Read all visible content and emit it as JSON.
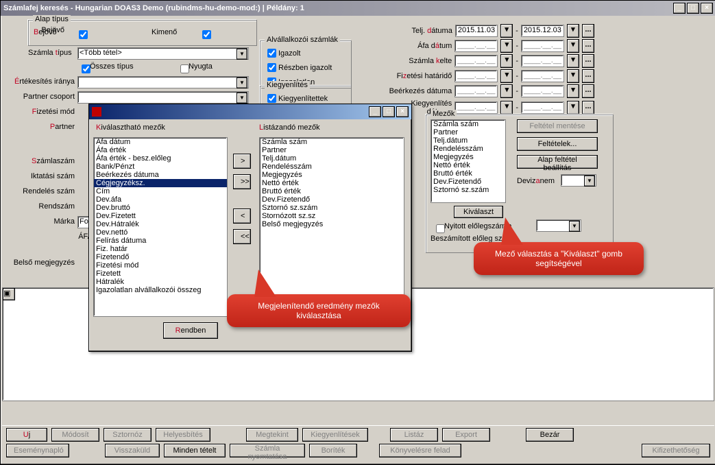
{
  "window": {
    "title": "Számlafej keresés - Hungarian DOAS3 Demo (rubindms-hu-demo-mod:)  |  Példány: 1",
    "min": "_",
    "max": "□",
    "close": "×"
  },
  "alap": {
    "group": "Alap típus",
    "bejovo": "Bejövő",
    "kimeno": "Kimenő"
  },
  "szamla_tipus": {
    "label": "Számla ",
    "label2": "típus",
    "value": "<Több tétel>",
    "osszes": "Összes típus",
    "nyugta": "Nyugta"
  },
  "labels": {
    "ert": "Értékesítés iránya",
    "pcso": "Partner csoport",
    "fiz": "izetési mód",
    "partner": "artner",
    "partnerP": "P",
    "szsz": "zámlaszám",
    "szszS": "S",
    "ikt": "Iktatási szám",
    "rend": "Rendelés szám",
    "rendsz": "Rendszám",
    "marka": "Márka",
    "afa": "ÁFA",
    "belso": "Belső megjegyzés",
    "forc": "Forc"
  },
  "alval": {
    "group": "Alvállalkozói számlák",
    "ig": "Igazolt",
    "re": "Részben igazolt",
    "igl": "Igazolatlan"
  },
  "kiegy": {
    "group": "Kiegyenlítés",
    "k1": "Kiegyenlítettek"
  },
  "dates": {
    "telj": {
      "l": "Telj. ",
      "l2": "dátuma",
      "f": "2015.11.03",
      "t": "2015.12.03"
    },
    "afa": {
      "l": "Áfa d",
      "l2": "átum",
      "f": "____.__.__",
      "t": "____.__.__"
    },
    "kelte": {
      "l": "Számla ",
      "l2": "kelte",
      "f": "____.__.__",
      "t": "____.__.__"
    },
    "hat": {
      "l": "Fi",
      "l2": "zetési határidő",
      "f": "____.__.__",
      "t": "____.__.__"
    },
    "beerk": {
      "l": "Beérkezés dátuma",
      "l2": "",
      "f": "____.__.__",
      "t": "____.__.__"
    },
    "kd": {
      "l": "Kiegyenlítés dátuma",
      "l2": "",
      "f": "____.__.__",
      "t": "____.__.__"
    },
    "dash": "-",
    "dots": "..."
  },
  "mezok": {
    "group": "Mezők",
    "items": [
      "Számla szám",
      "Partner",
      "Telj.dátum",
      "Rendelésszám",
      "Megjegyzés",
      "Nettó érték",
      "Bruttó érték",
      "Dev.Fizetendő",
      "Sztornó sz.szám"
    ],
    "kivalaszt": "Kiválaszt",
    "felt_ment": "Feltétel mentése",
    "feltetelek": "Feltételek...",
    "alap": "Alap feltétel beállítás",
    "deviz": "Devizanem",
    "nyitott": "Nyitott előlegszámla",
    "beszam": "Beszámított előleg száma"
  },
  "modal": {
    "title": "",
    "leftcap": "iválasztható mezők",
    "leftcapK": "K",
    "rightcap": "istázandó mezők",
    "rightcapL": "L",
    "left": [
      "Áfa dátum",
      "Áfa érték",
      "Áfa érték - besz.előleg",
      "Bank/Pénzt",
      "Beérkezés dátuma",
      "Cégjegyzéksz.",
      "Cím",
      "Dev.áfa",
      "Dev.bruttó",
      "Dev.Fizetett",
      "Dev.Hátralék",
      "Dev.nettó",
      "Felírás dátuma",
      "Fiz. határ",
      "Fizetendő",
      "Fizetési mód",
      "Fizetett",
      "Hátralék",
      "Igazolatlan alvállalkozói összeg"
    ],
    "leftsel": 5,
    "right": [
      "Számla szám",
      "Partner",
      "Telj.dátum",
      "Rendelésszám",
      "Megjegyzés",
      "Nettó érték",
      "Bruttó érték",
      "Dev.Fizetendő",
      "Sztornó sz.szám",
      "Stornózott sz.sz",
      "Belső megjegyzés"
    ],
    "add": ">",
    "addall": ">>",
    "rem": "<",
    "remall": "<<",
    "ok": "endben",
    "okR": "R"
  },
  "tip1": "Megjelenítendő eredmény mezők kiválasztása",
  "tip2": "Mező választás a \"Kiválaszt\" gomb segítségével",
  "buttons": {
    "uj": "j",
    "ujU": "U",
    "modosit": "Módosít",
    "sztornoz": "Sztornóz",
    "helyes": "Helyesbítés",
    "megtek": "Megtekint",
    "kiegyl": "Kiegyenlítések",
    "listaz": "Listáz",
    "export": "Export",
    "bezar": "Bezár",
    "esem": "Eseménynapló",
    "vissza": "Visszaküld",
    "minden": "Minden tételt",
    "nyomt": "Számla nyomtatása",
    "borit": "Boríték",
    "konyv": "Könyvelésre felad",
    "kif": "Kifizethetőség"
  }
}
